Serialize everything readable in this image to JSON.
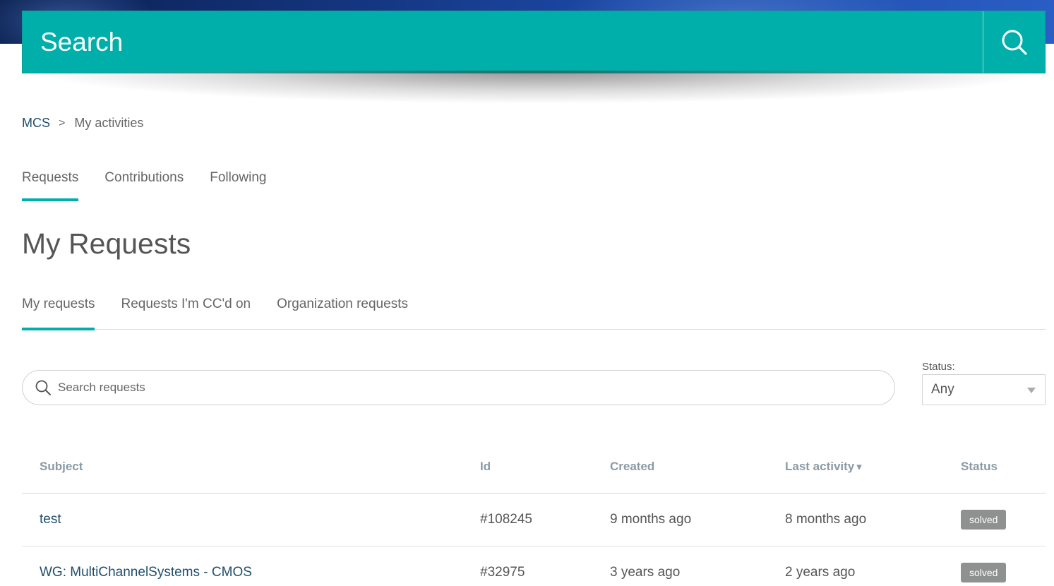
{
  "header": {
    "search_placeholder": "Search",
    "search_icon": "search-icon"
  },
  "breadcrumb": {
    "root": "MCS",
    "separator": ">",
    "current": "My activities"
  },
  "activity_tabs": [
    {
      "label": "Requests",
      "active": true
    },
    {
      "label": "Contributions",
      "active": false
    },
    {
      "label": "Following",
      "active": false
    }
  ],
  "page_title": "My Requests",
  "request_tabs": [
    {
      "label": "My requests",
      "active": true
    },
    {
      "label": "Requests I'm CC'd on",
      "active": false
    },
    {
      "label": "Organization requests",
      "active": false
    }
  ],
  "request_search": {
    "placeholder": "Search requests"
  },
  "status_filter": {
    "label": "Status:",
    "selected": "Any"
  },
  "table": {
    "headers": {
      "subject": "Subject",
      "id": "Id",
      "created": "Created",
      "last_activity": "Last activity",
      "sort_indicator": "▾",
      "status": "Status"
    },
    "rows": [
      {
        "subject": "test",
        "id": "#108245",
        "created": "9 months ago",
        "last_activity": "8 months ago",
        "status": "solved"
      },
      {
        "subject": "WG: MultiChannelSystems - CMOS",
        "id": "#32975",
        "created": "3 years ago",
        "last_activity": "2 years ago",
        "status": "solved"
      }
    ]
  },
  "colors": {
    "accent": "#00afaa",
    "link": "#1f4e6b",
    "badge": "#8f9090"
  }
}
